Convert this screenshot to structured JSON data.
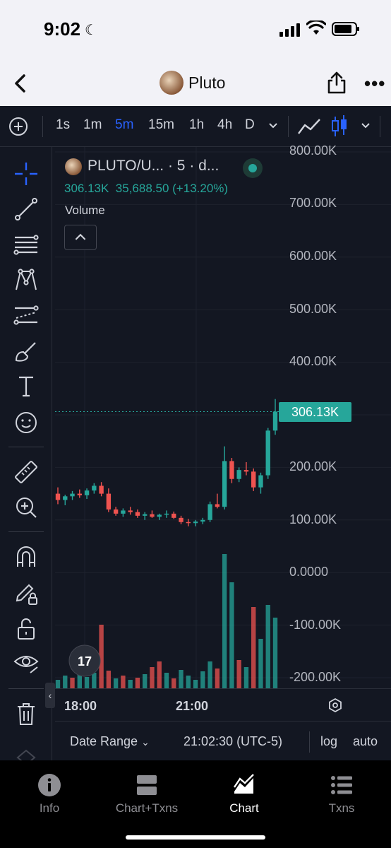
{
  "status": {
    "time": "9:02"
  },
  "nav": {
    "title": "Pluto"
  },
  "toolbar": {
    "timeframes": [
      "1s",
      "1m",
      "5m",
      "15m",
      "1h",
      "4h",
      "D"
    ],
    "active_timeframe": "5m"
  },
  "legend": {
    "title": "PLUTO/U... · 5 · d...",
    "price": "306.13K",
    "change": "35,688.50 (+13.20%)",
    "volume_label": "Volume"
  },
  "price_axis": {
    "ticks": [
      "800.00K",
      "700.00K",
      "600.00K",
      "500.00K",
      "400.00K",
      "300.00K",
      "200.00K",
      "100.00K",
      "0.0000",
      "-100.00K",
      "-200.00K"
    ],
    "last_price_label": "306.13K"
  },
  "time_axis": {
    "ticks": [
      "18:00",
      "21:00"
    ]
  },
  "bottom_controls": {
    "date_range": "Date Range",
    "clock": "21:02:30 (UTC-5)",
    "log": "log",
    "auto": "auto"
  },
  "tabs": [
    {
      "label": "Info",
      "active": false
    },
    {
      "label": "Chart+Txns",
      "active": false
    },
    {
      "label": "Chart",
      "active": true
    },
    {
      "label": "Txns",
      "active": false
    }
  ],
  "colors": {
    "up": "#26a69a",
    "down": "#ef5350",
    "accent": "#2962ff",
    "background": "#131722"
  },
  "chart_data": {
    "type": "candlestick",
    "ylim": [
      -200000,
      800000
    ],
    "candles": [
      {
        "o": 150000,
        "h": 162000,
        "l": 130000,
        "c": 138000
      },
      {
        "o": 138000,
        "h": 148000,
        "l": 128000,
        "c": 145000
      },
      {
        "o": 145000,
        "h": 155000,
        "l": 138000,
        "c": 150000
      },
      {
        "o": 150000,
        "h": 158000,
        "l": 142000,
        "c": 147000
      },
      {
        "o": 147000,
        "h": 160000,
        "l": 140000,
        "c": 156000
      },
      {
        "o": 156000,
        "h": 170000,
        "l": 150000,
        "c": 165000
      },
      {
        "o": 165000,
        "h": 172000,
        "l": 145000,
        "c": 150000
      },
      {
        "o": 150000,
        "h": 160000,
        "l": 115000,
        "c": 120000
      },
      {
        "o": 120000,
        "h": 125000,
        "l": 108000,
        "c": 112000
      },
      {
        "o": 112000,
        "h": 122000,
        "l": 106000,
        "c": 118000
      },
      {
        "o": 118000,
        "h": 125000,
        "l": 110000,
        "c": 115000
      },
      {
        "o": 115000,
        "h": 120000,
        "l": 104000,
        "c": 108000
      },
      {
        "o": 108000,
        "h": 115000,
        "l": 100000,
        "c": 111000
      },
      {
        "o": 111000,
        "h": 118000,
        "l": 104000,
        "c": 106000
      },
      {
        "o": 106000,
        "h": 112000,
        "l": 100000,
        "c": 110000
      },
      {
        "o": 110000,
        "h": 118000,
        "l": 104000,
        "c": 112000
      },
      {
        "o": 112000,
        "h": 116000,
        "l": 102000,
        "c": 104000
      },
      {
        "o": 104000,
        "h": 108000,
        "l": 92000,
        "c": 96000
      },
      {
        "o": 96000,
        "h": 102000,
        "l": 88000,
        "c": 94000
      },
      {
        "o": 94000,
        "h": 100000,
        "l": 88000,
        "c": 97000
      },
      {
        "o": 97000,
        "h": 104000,
        "l": 92000,
        "c": 100000
      },
      {
        "o": 100000,
        "h": 135000,
        "l": 96000,
        "c": 130000
      },
      {
        "o": 130000,
        "h": 150000,
        "l": 122000,
        "c": 125000
      },
      {
        "o": 125000,
        "h": 240000,
        "l": 120000,
        "c": 212000
      },
      {
        "o": 212000,
        "h": 218000,
        "l": 170000,
        "c": 178000
      },
      {
        "o": 178000,
        "h": 200000,
        "l": 172000,
        "c": 195000
      },
      {
        "o": 195000,
        "h": 210000,
        "l": 185000,
        "c": 192000
      },
      {
        "o": 192000,
        "h": 198000,
        "l": 155000,
        "c": 162000
      },
      {
        "o": 162000,
        "h": 190000,
        "l": 150000,
        "c": 185000
      },
      {
        "o": 185000,
        "h": 275000,
        "l": 178000,
        "c": 270000
      },
      {
        "o": 270000,
        "h": 330000,
        "l": 262000,
        "c": 306130
      }
    ],
    "volumes": [
      {
        "v": 12,
        "up": true
      },
      {
        "v": 18,
        "up": true
      },
      {
        "v": 15,
        "up": false
      },
      {
        "v": 20,
        "up": true
      },
      {
        "v": 16,
        "up": true
      },
      {
        "v": 22,
        "up": true
      },
      {
        "v": 90,
        "up": false
      },
      {
        "v": 25,
        "up": false
      },
      {
        "v": 14,
        "up": true
      },
      {
        "v": 18,
        "up": false
      },
      {
        "v": 12,
        "up": true
      },
      {
        "v": 15,
        "up": false
      },
      {
        "v": 20,
        "up": true
      },
      {
        "v": 30,
        "up": false
      },
      {
        "v": 38,
        "up": false
      },
      {
        "v": 22,
        "up": true
      },
      {
        "v": 14,
        "up": false
      },
      {
        "v": 26,
        "up": true
      },
      {
        "v": 18,
        "up": true
      },
      {
        "v": 12,
        "up": true
      },
      {
        "v": 24,
        "up": true
      },
      {
        "v": 38,
        "up": true
      },
      {
        "v": 28,
        "up": false
      },
      {
        "v": 190,
        "up": true
      },
      {
        "v": 150,
        "up": true
      },
      {
        "v": 40,
        "up": false
      },
      {
        "v": 30,
        "up": true
      },
      {
        "v": 115,
        "up": false
      },
      {
        "v": 70,
        "up": true
      },
      {
        "v": 118,
        "up": true
      },
      {
        "v": 100,
        "up": true
      }
    ]
  }
}
